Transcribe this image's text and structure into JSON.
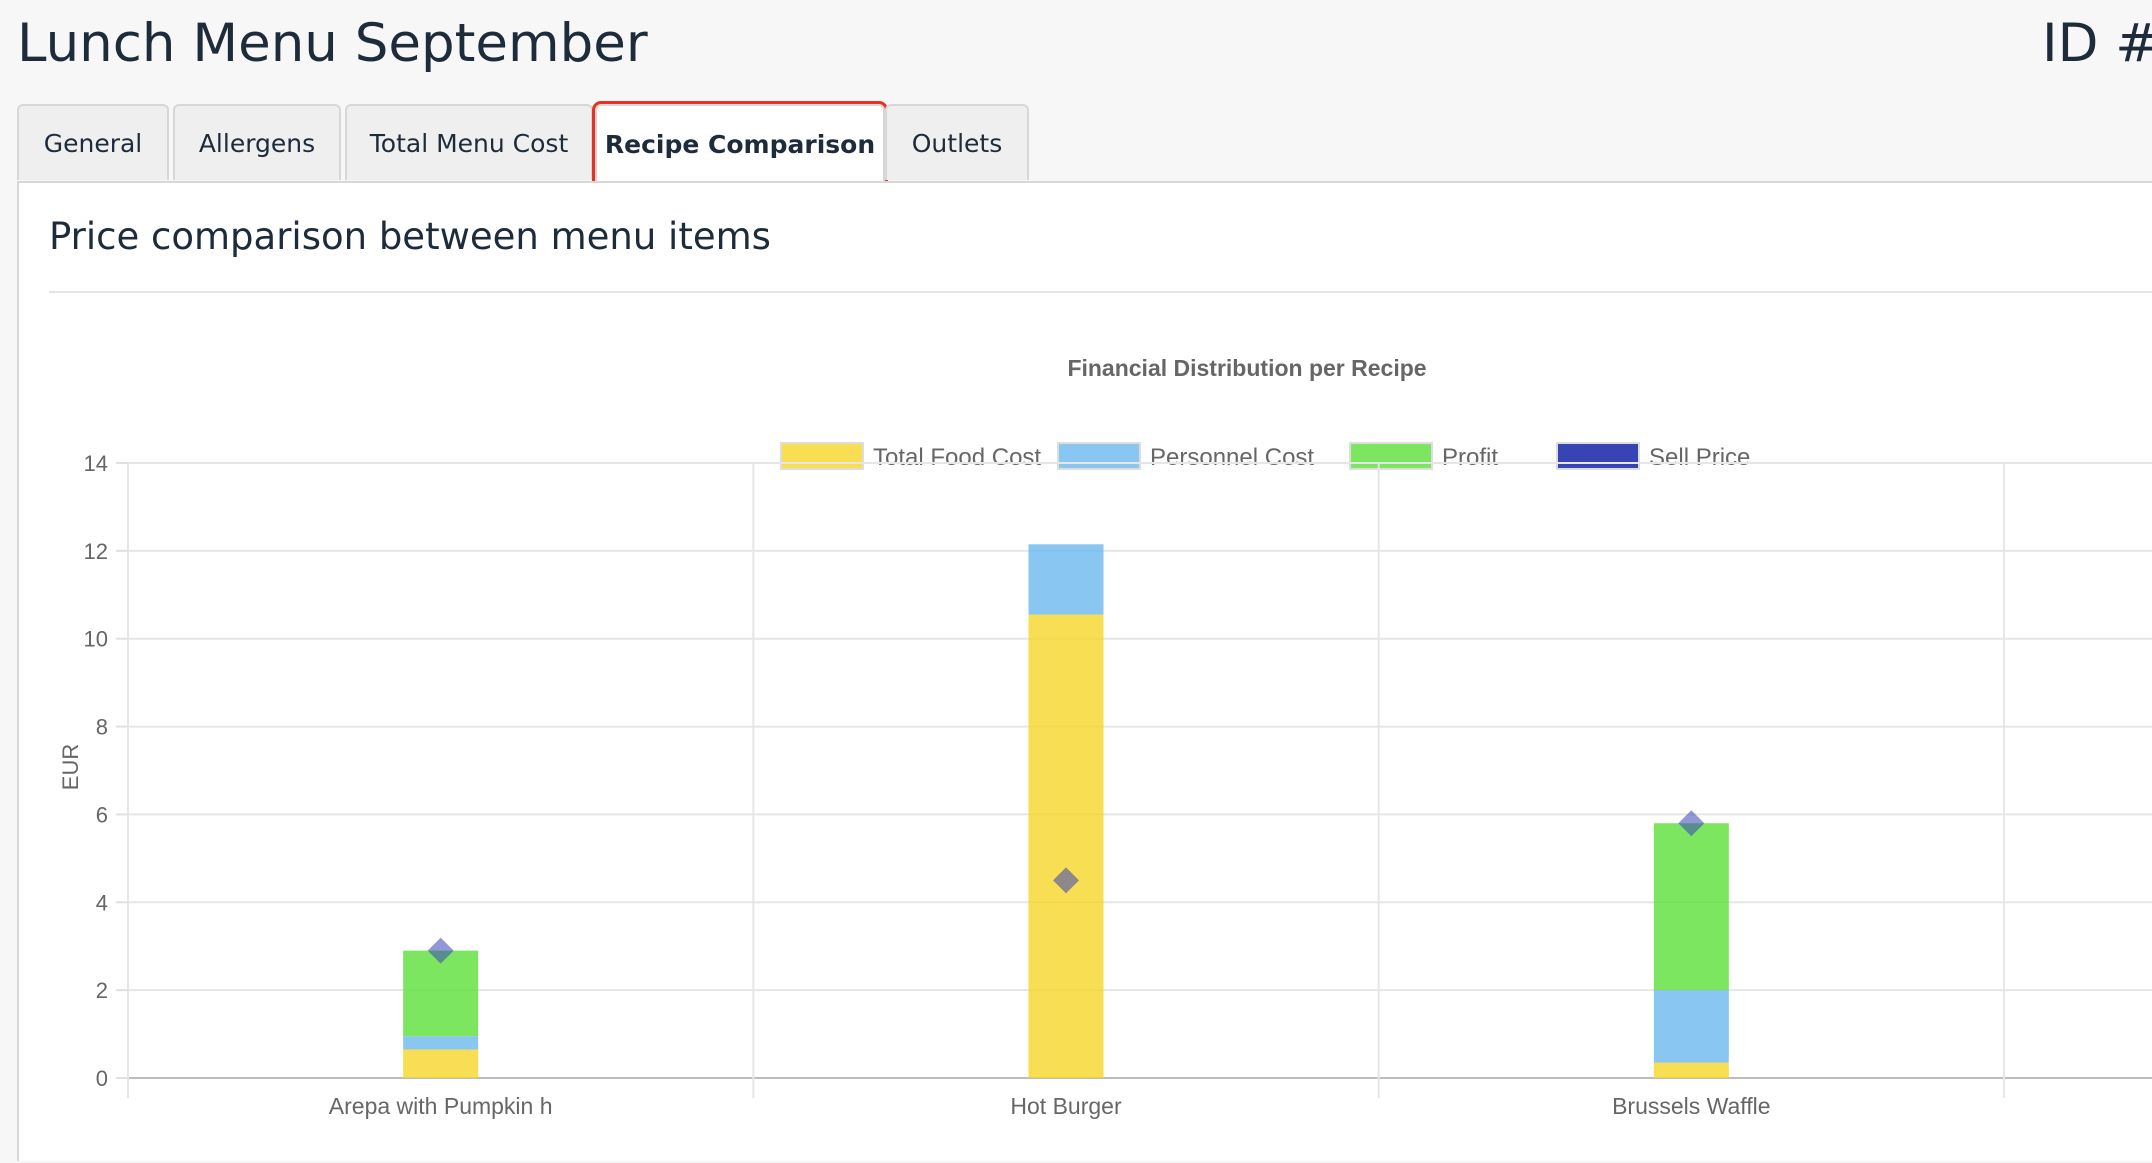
{
  "header": {
    "title": "Lunch Menu September",
    "id_label": "ID #"
  },
  "tabs": [
    {
      "label": "General",
      "active": false
    },
    {
      "label": "Allergens",
      "active": false
    },
    {
      "label": "Total Menu Cost",
      "active": false
    },
    {
      "label": "Recipe Comparison",
      "active": true
    },
    {
      "label": "Outlets",
      "active": false
    }
  ],
  "panel": {
    "heading": "Price comparison between menu items"
  },
  "colors": {
    "food_cost": "#f5d627",
    "personnel_cost": "#6cb9ef",
    "profit": "#5be03a",
    "sell_price": "#3843b4",
    "tab_highlight": "#e53222"
  },
  "chart_data": {
    "type": "bar",
    "stacked": true,
    "title": "Financial Distribution per Recipe",
    "ylabel": "EUR",
    "xlabel": "",
    "ylim": [
      0,
      14
    ],
    "yticks": [
      0,
      2,
      4,
      6,
      8,
      10,
      12,
      14
    ],
    "grid": true,
    "legend_position": "top",
    "categories": [
      "Arepa with Pumpkin h",
      "Hot Burger",
      "Brussels Waffle"
    ],
    "series": [
      {
        "name": "Total Food Cost",
        "kind": "bar",
        "values": [
          0.65,
          10.55,
          0.35
        ]
      },
      {
        "name": "Personnel Cost",
        "kind": "bar",
        "values": [
          0.3,
          1.6,
          1.65
        ]
      },
      {
        "name": "Profit",
        "kind": "bar",
        "values": [
          1.95,
          0,
          3.8
        ]
      },
      {
        "name": "Sell Price",
        "kind": "point",
        "values": [
          2.9,
          4.5,
          5.8
        ]
      }
    ]
  }
}
